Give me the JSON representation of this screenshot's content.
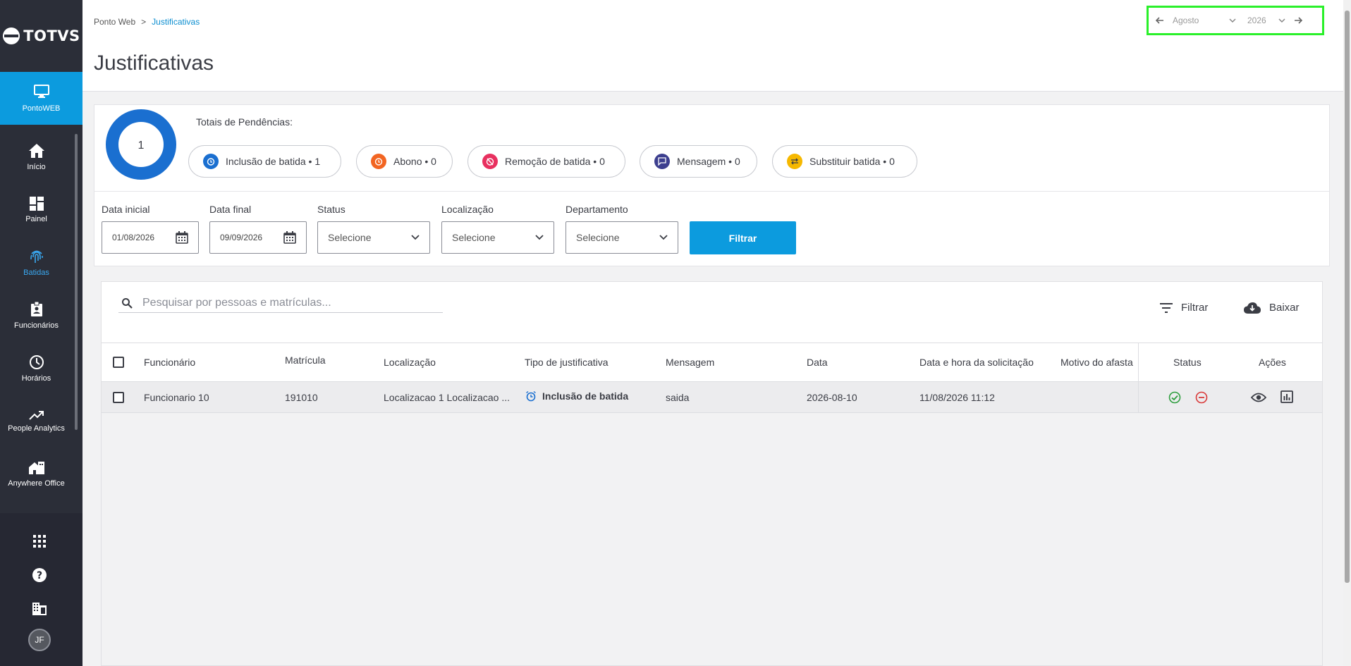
{
  "brand": {
    "name": "TOTVS"
  },
  "sidebar": {
    "active": {
      "label": "PontoWEB",
      "icon": "monitor-icon"
    },
    "items": [
      {
        "label": "Início",
        "icon": "home-icon"
      },
      {
        "label": "Painel",
        "icon": "dashboard-icon"
      },
      {
        "label": "Batidas",
        "icon": "fingerprint-icon"
      },
      {
        "label": "Funcionários",
        "icon": "badge-icon"
      },
      {
        "label": "Horários",
        "icon": "clock-icon"
      },
      {
        "label": "People Analytics",
        "icon": "trending-up-icon"
      },
      {
        "label": "Anywhere Office",
        "icon": "home-work-icon"
      }
    ],
    "user_initials": "JF"
  },
  "header": {
    "breadcrumb": [
      "Ponto Web",
      "Justificativas"
    ],
    "breadcrumb_sep": ">",
    "title": "Justificativas",
    "month": "Agosto",
    "year": "2026"
  },
  "summary": {
    "total": "1",
    "title": "Totais de Pendências:",
    "chips": [
      {
        "label": "Inclusão de batida",
        "count": "1",
        "color": "#1a6fd0"
      },
      {
        "label": "Abono",
        "count": "0",
        "color": "#f26522"
      },
      {
        "label": "Remoção de batida",
        "count": "0",
        "color": "#e8305f"
      },
      {
        "label": "Mensagem",
        "count": "0",
        "color": "#3d3f8f"
      },
      {
        "label": "Substituir batida",
        "count": "0",
        "color": "#f6b800"
      }
    ]
  },
  "filters": {
    "start_label": "Data inicial",
    "start_value": "01/08/2026",
    "end_label": "Data final",
    "end_value": "09/09/2026",
    "status_label": "Status",
    "location_label": "Localização",
    "department_label": "Departamento",
    "select_placeholder": "Selecione",
    "submit": "Filtrar"
  },
  "table": {
    "search_placeholder": "Pesquisar por pessoas e matrículas...",
    "filter_label": "Filtrar",
    "download_label": "Baixar",
    "columns": [
      "Funcionário",
      "Matrícula",
      "Localização",
      "Tipo de justificativa",
      "Mensagem",
      "Data",
      "Data e hora da solicitação",
      "Motivo do afasta",
      "Status",
      "Ações"
    ],
    "rows": [
      {
        "employee": "Funcionario 10",
        "registration": "191010",
        "location": "Localizacao 1 Localizacao ...",
        "type": "Inclusão de batida",
        "message": "saida",
        "date": "2026-08-10",
        "requested_at": "11/08/2026 11:12",
        "reason": ""
      }
    ]
  }
}
